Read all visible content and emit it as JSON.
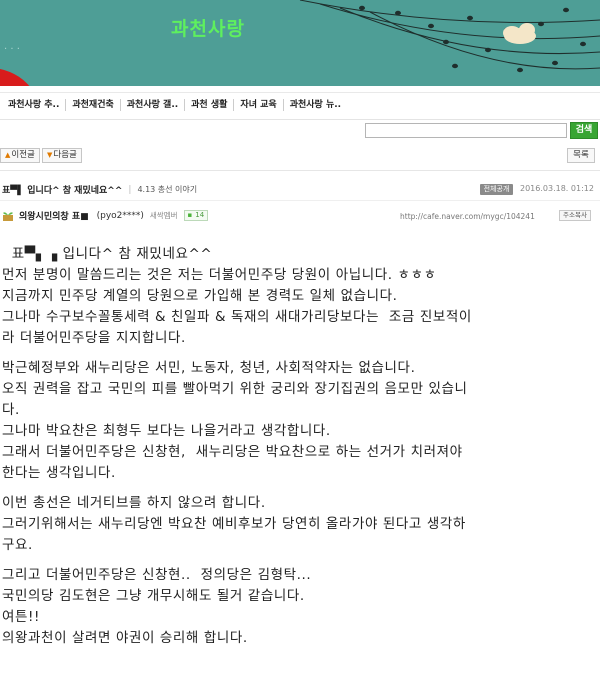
{
  "banner": {
    "title": "과천사랑",
    "dots": "·  ·  ·",
    "colors": {
      "background": "#4e9e96",
      "title": "#5ef05e",
      "accent_red": "#d81c1c"
    }
  },
  "menu": {
    "items": [
      "과천사랑 추..",
      "과천재건축",
      "과천사랑 갤..",
      "과천 생활",
      "자녀 교육",
      "과천사랑 뉴.."
    ]
  },
  "search": {
    "value": "",
    "placeholder": "",
    "button_label": "검색"
  },
  "nav": {
    "prev_label": "이전글",
    "next_label": "다음글",
    "list_label": "목록",
    "prev_arrow": "▲",
    "next_arrow": "▼"
  },
  "post": {
    "title": "표▀▌ 입니다^ 참 재밌네요^^",
    "separator": "|",
    "board": "4.13 총선 이야기",
    "public_badge": "전체공개",
    "date": "2016.03.18. 01:12",
    "author": {
      "name": "의왕시민의창 표■",
      "id": "(pyo2****)",
      "level": "새싹멤버",
      "comment_icon": "▪",
      "comment_count": "14",
      "avatar_icon": "sprout-icon"
    },
    "url": "http://cafe.naver.com/mygc/104241",
    "copy_label": "주소복사"
  },
  "body": {
    "lines": [
      "  표▀▖▗ 입니다^ 참 재밌네요^^",
      "먼저 분명이 말씀드리는 것은 저는 더불어민주당 당원이 아닙니다. ㅎㅎㅎ",
      "지금까지 민주당 계열의 당원으로 가입해 본 경력도 일체 없습니다.",
      "그나마 수구보수꼴통세력 & 친일파 & 독재의 새대가리당보다는  조금 진보적이",
      "라 더불어민주당을 지지합니다.",
      "박근혜정부와 새누리당은 서민, 노동자, 청년, 사회적약자는 없습니다.",
      "오직 권력을 잡고 국민의 피를 빨아먹기 위한 궁리와 장기집권의 음모만 있습니",
      "다.",
      "그나마 박요찬은 최형두 보다는 나을거라고 생각합니다.",
      "그래서 더불어민주당은 신창현,  새누리당은 박요찬으로 하는 선거가 치러져야",
      "한다는 생각입니다.",
      "이번 총선은 네거티브를 하지 않으려 합니다.",
      "그러기위해서는 새누리당엔 박요찬 예비후보가 당연히 올라가야 된다고 생각하",
      "구요.",
      "그리고 더불어민주당은 신창현..  정의당은 김형탁...",
      "국민의당 김도현은 그냥 개무시해도 될거 같습니다.",
      "여튼!!",
      "의왕과천이 살려면 야권이 승리해 합니다."
    ]
  }
}
